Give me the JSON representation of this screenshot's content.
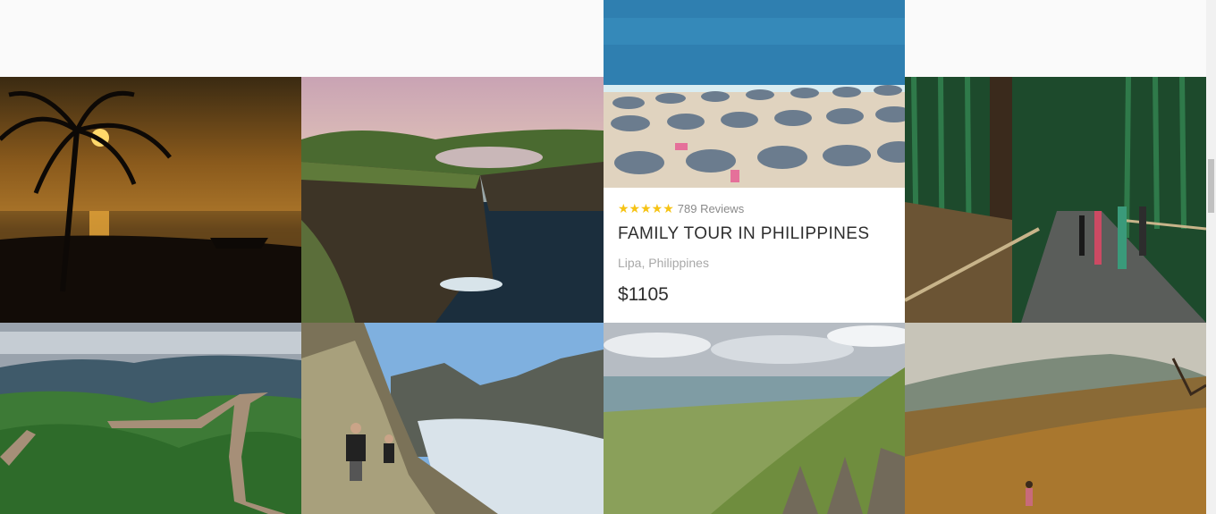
{
  "tiles": [
    {
      "id": "sunset",
      "name": "sunset-palm-image"
    },
    {
      "id": "cliffs",
      "name": "sea-cliffs-lake-image"
    },
    {
      "id": "beach",
      "name": "beach-umbrellas-image"
    },
    {
      "id": "bamboo",
      "name": "bamboo-forest-image"
    },
    {
      "id": "wall",
      "name": "great-wall-image"
    },
    {
      "id": "hike",
      "name": "mountain-hikers-image"
    },
    {
      "id": "valley",
      "name": "green-valley-image"
    },
    {
      "id": "meadow",
      "name": "golden-meadow-image"
    }
  ],
  "featured_tour": {
    "rating_stars": "★★★★★",
    "rating_value": 5,
    "reviews": "789 Reviews",
    "title": "FAMILY TOUR IN PHILIPPINES",
    "location": "Lipa, Philippines",
    "price": "$1105"
  },
  "colors": {
    "star": "#f6c314",
    "title": "#2e2e2e",
    "muted": "#a8a8a8",
    "background": "#fafafa"
  }
}
